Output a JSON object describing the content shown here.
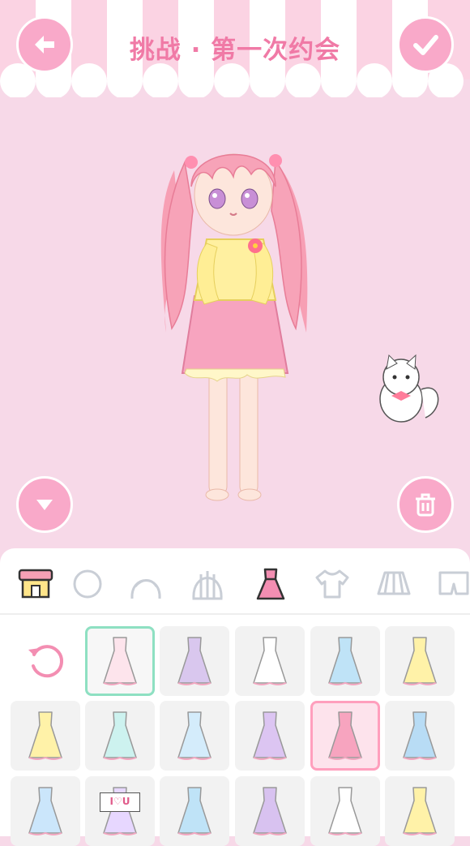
{
  "header": {
    "title": "挑战 · 第一次约会",
    "back_icon": "back-arrow-icon",
    "confirm_icon": "check-icon"
  },
  "stage": {
    "collapse_icon": "chevron-down-icon",
    "trash_icon": "trash-icon",
    "character": "girl-doll",
    "pet": "white-cat"
  },
  "colors": {
    "background": "#f7d9e8",
    "button": "#f9a9c9",
    "title": "#f07aa6",
    "selected_green": "#8ee0c2",
    "selected_pink": "#ff9fbd"
  },
  "tabs": [
    {
      "name": "shop-icon",
      "active": false
    },
    {
      "name": "face-icon",
      "active": false
    },
    {
      "name": "hair-front-icon",
      "active": false
    },
    {
      "name": "hair-back-icon",
      "active": false
    },
    {
      "name": "dress-icon",
      "active": true
    },
    {
      "name": "top-icon",
      "active": false
    },
    {
      "name": "skirt-icon",
      "active": false
    },
    {
      "name": "pants-icon",
      "active": false
    }
  ],
  "items": {
    "reset_icon": "reset-icon",
    "grid": [
      {
        "name": "white-bow-dress",
        "selected": "green"
      },
      {
        "name": "plaid-purple-dress",
        "selected": ""
      },
      {
        "name": "white-slip-dress",
        "selected": ""
      },
      {
        "name": "blue-slip-dress",
        "selected": ""
      },
      {
        "name": "yellow-lace-dress",
        "selected": ""
      },
      {
        "name": "yellow-babydoll-dress",
        "selected": ""
      },
      {
        "name": "mint-ruffle-dress",
        "selected": ""
      },
      {
        "name": "blue-tutu-dress",
        "selected": ""
      },
      {
        "name": "purple-princess-dress",
        "selected": ""
      },
      {
        "name": "pink-cardigan-dress",
        "selected": "pink"
      },
      {
        "name": "blue-layered-dress",
        "selected": ""
      },
      {
        "name": "blue-frill-dress",
        "selected": ""
      },
      {
        "name": "i-love-u-dress",
        "text": "I♡U",
        "selected": ""
      },
      {
        "name": "sailor-dress",
        "selected": ""
      },
      {
        "name": "purple-sailor-dress",
        "selected": ""
      },
      {
        "name": "white-apron-dress",
        "selected": ""
      },
      {
        "name": "yellow-coat-dress",
        "selected": ""
      }
    ]
  }
}
